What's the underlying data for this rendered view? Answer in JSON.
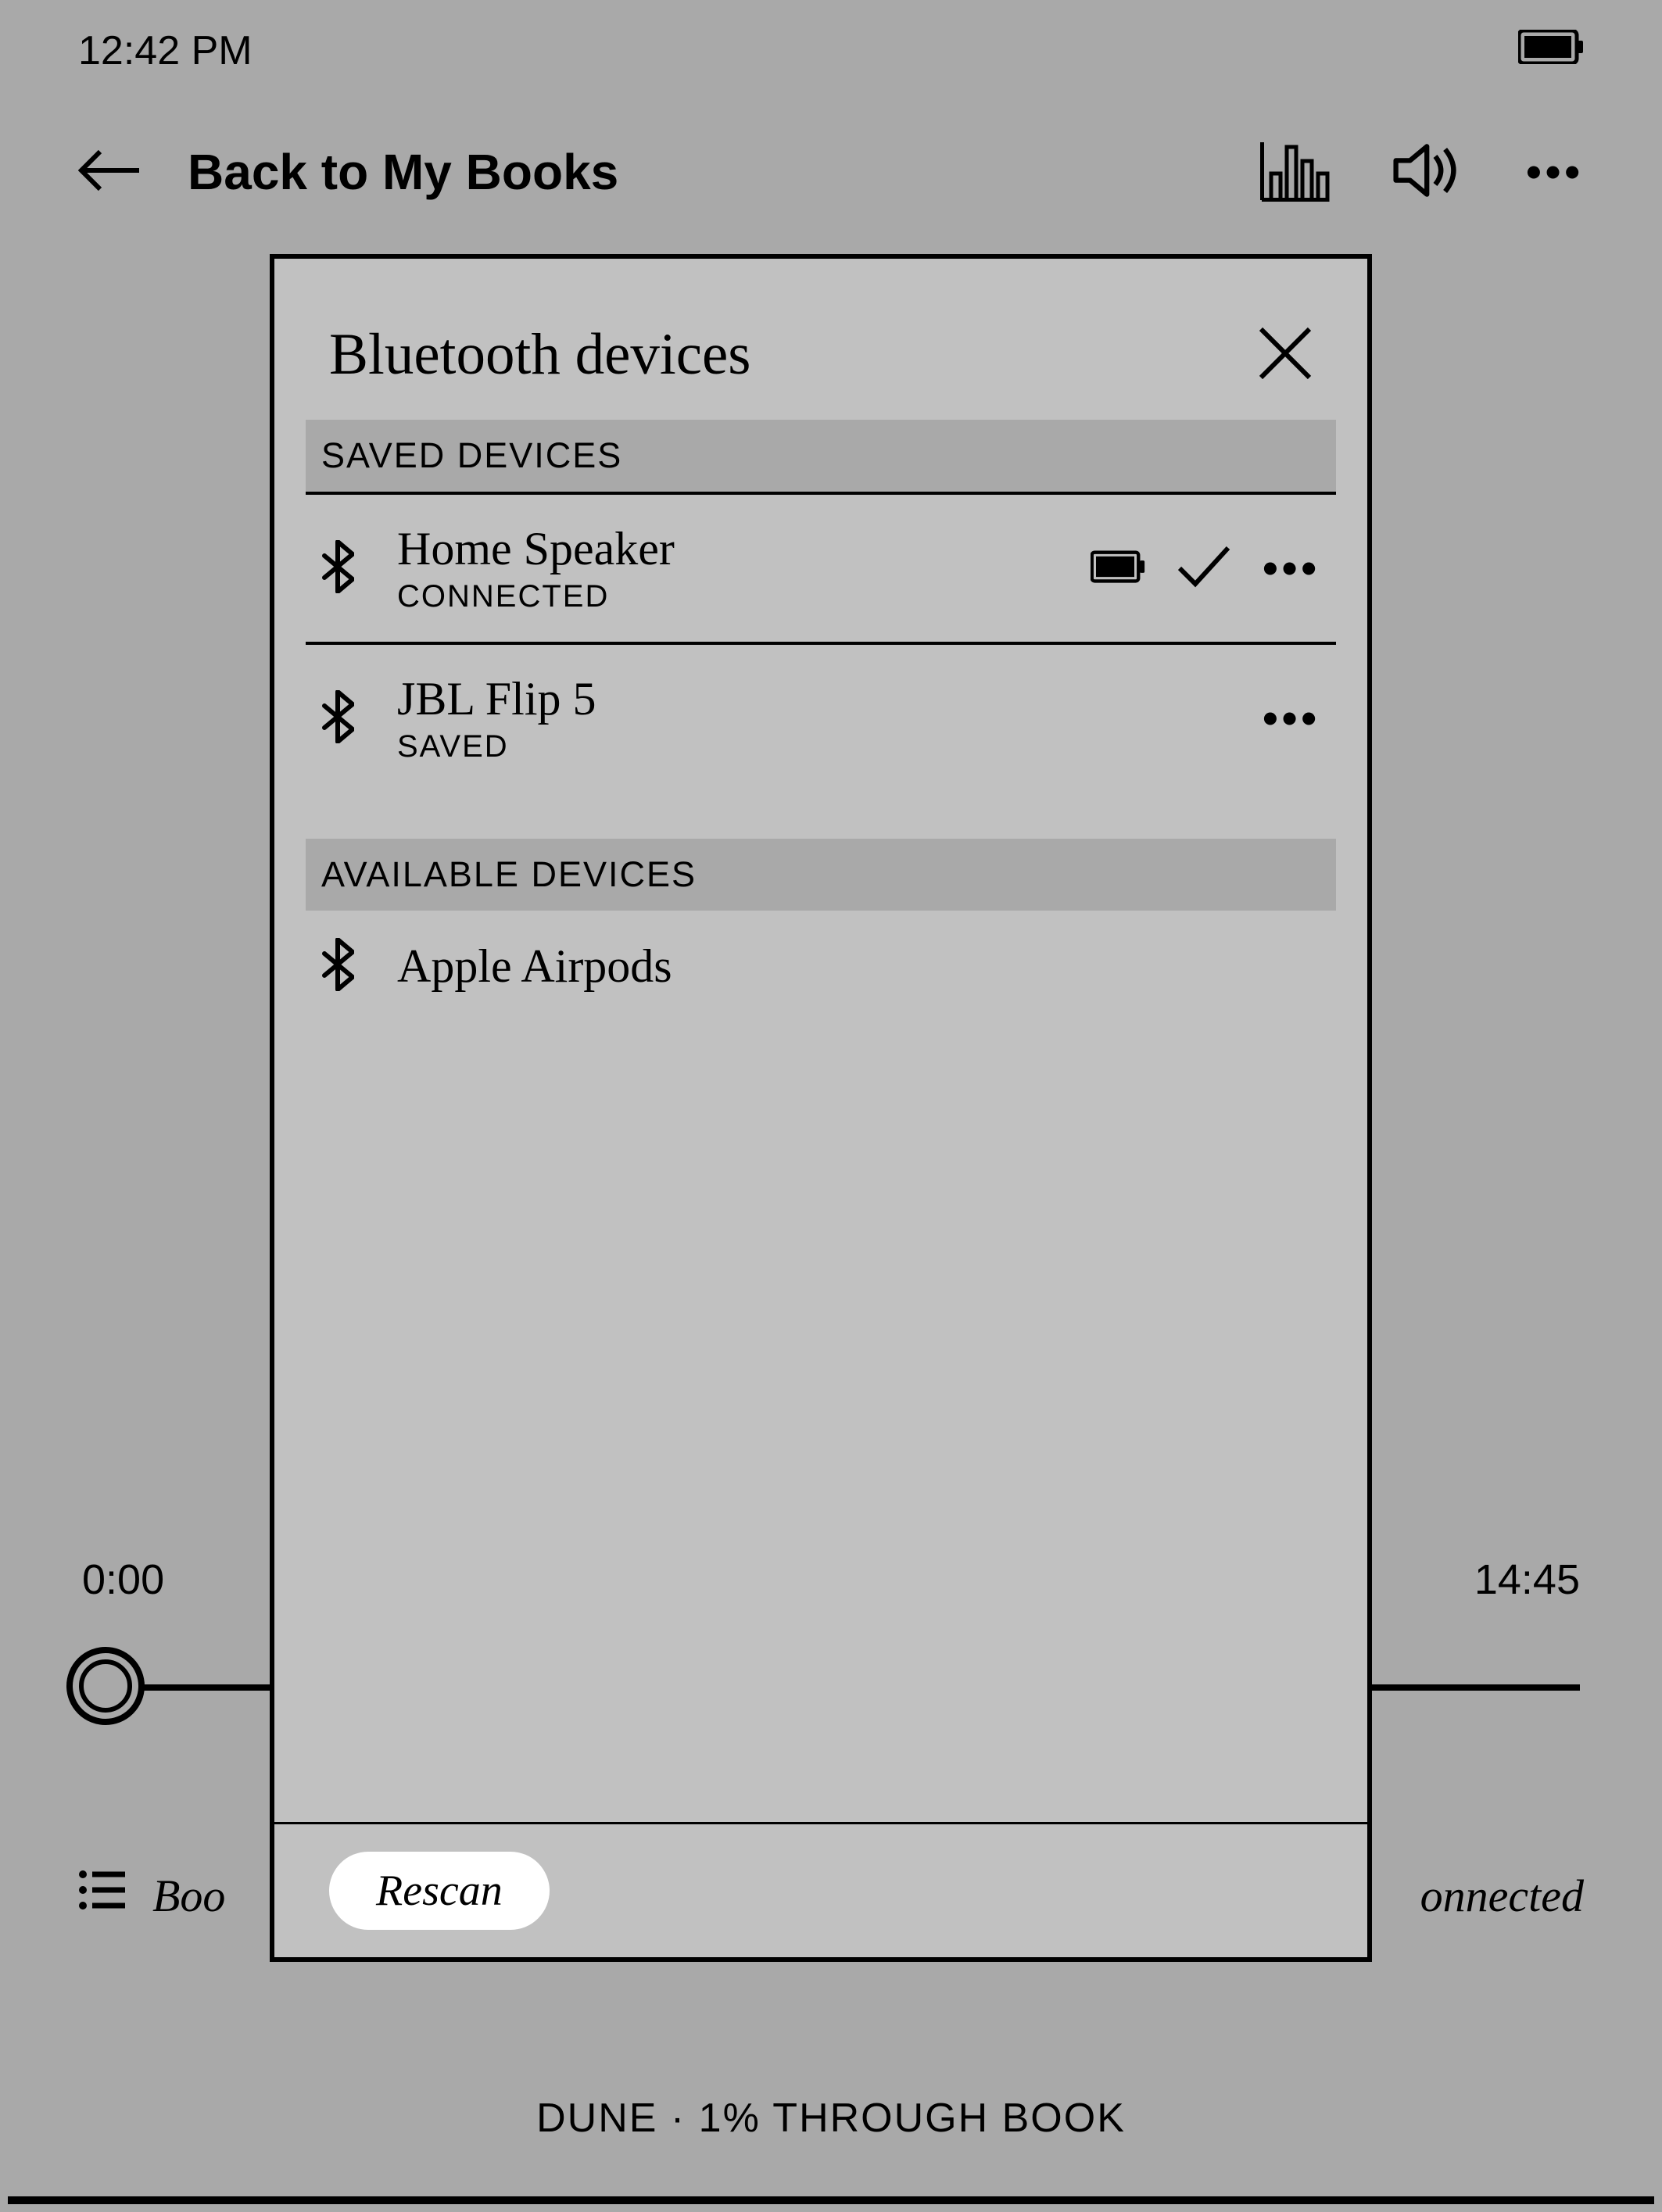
{
  "status": {
    "time": "12:42 PM"
  },
  "header": {
    "back_label": "Back to My Books"
  },
  "player": {
    "elapsed": "0:00",
    "total": "14:45",
    "bottom_left_truncated": "Boo",
    "bottom_right_truncated": "onnected"
  },
  "footer": {
    "progress_text": "DUNE · 1% THROUGH BOOK"
  },
  "modal": {
    "title": "Bluetooth devices",
    "sections": {
      "saved_header": "SAVED DEVICES",
      "available_header": "AVAILABLE DEVICES"
    },
    "saved_devices": [
      {
        "name": "Home Speaker",
        "status": "CONNECTED",
        "show_battery": true,
        "show_check": true
      },
      {
        "name": "JBL Flip 5",
        "status": "SAVED",
        "show_battery": false,
        "show_check": false
      }
    ],
    "available_devices": [
      {
        "name": "Apple Airpods"
      }
    ],
    "rescan_label": "Rescan"
  }
}
